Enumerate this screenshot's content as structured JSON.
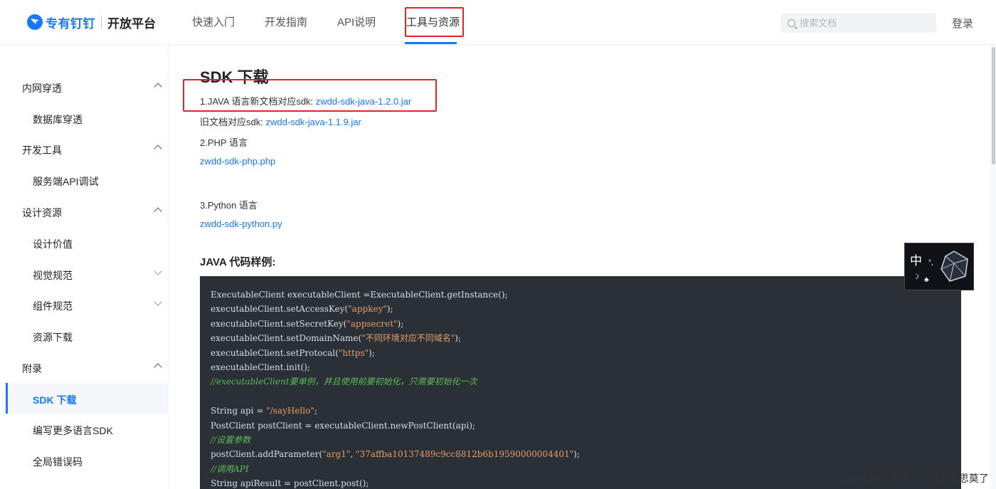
{
  "header": {
    "brand": "专有钉钉",
    "subtitle": "开放平台",
    "nav": [
      {
        "label": "快速入门"
      },
      {
        "label": "开发指南"
      },
      {
        "label": "API说明"
      },
      {
        "label": "工具与资源"
      }
    ],
    "search_placeholder": "搜索文档",
    "login_label": "登录"
  },
  "sidebar": {
    "groups": [
      {
        "label": "内网穿透"
      },
      {
        "label": "开发工具"
      },
      {
        "label": "设计资源"
      },
      {
        "label": "附录"
      }
    ],
    "items": [
      {
        "label": "数据库穿透"
      },
      {
        "label": "服务端API调试"
      },
      {
        "label": "设计价值"
      },
      {
        "label": "视觉规范"
      },
      {
        "label": "组件规范"
      },
      {
        "label": "资源下载"
      },
      {
        "label": "SDK 下载"
      },
      {
        "label": "编写更多语言SDK"
      },
      {
        "label": "全局错误码"
      }
    ]
  },
  "main": {
    "title": "SDK 下载",
    "java_new_prefix": "1.JAVA 语言新文档对应sdk: ",
    "java_new_link": "zwdd-sdk-java-1.2.0.jar",
    "java_old_prefix": "旧文档对应sdk: ",
    "java_old_link": "zwdd-sdk-java-1.1.9.jar",
    "php_label": "2.PHP 语言",
    "php_link": "zwdd-sdk-php.php",
    "python_label": "3.Python 语言",
    "python_link": "zwdd-sdk-python.py",
    "code_heading": "JAVA 代码样例:",
    "code": {
      "l1": "ExecutableClient executableClient =ExecutableClient.getInstance();",
      "l2a": "executableClient.setAccessKey(",
      "l2s": "\"appkey\"",
      "l2b": ");",
      "l3a": "executableClient.setSecretKey(",
      "l3s": "\"appsecret\"",
      "l3b": ");",
      "l4a": "executableClient.setDomainName(",
      "l4s": "\"不同环境对应不同域名\"",
      "l4b": ");",
      "l5a": "executableClient.setProtocal(",
      "l5s": "\"https\"",
      "l5b": ");",
      "l6": "executableClient.init();",
      "l7": "//executableClient要单例，并且使用前要初始化，只需要初始化一次",
      "l9a": "String api = ",
      "l9s": "\"/sayHello\"",
      "l9b": ";",
      "l10": "PostClient postClient = executableClient.newPostClient(api);",
      "l11": "//设置参数",
      "l12a": "postClient.addParameter(",
      "l12s1": "\"arg1\"",
      "l12m": ", ",
      "l12s2": "\"37affba10137489c9cc8812b6b19590000004401\"",
      "l12b": ");",
      "l13": "//调用API",
      "l14": "String apiResult = postClient.post();"
    }
  },
  "floating_widget": {
    "char": "中"
  },
  "watermark": "CSDN @郭老师的小迷弟雅思莫了",
  "colors": {
    "accent": "#1677ff",
    "annotation": "#e8222a",
    "code_bg": "#2b3036",
    "code_string": "#e59c68",
    "code_comment": "#5cb85c"
  }
}
